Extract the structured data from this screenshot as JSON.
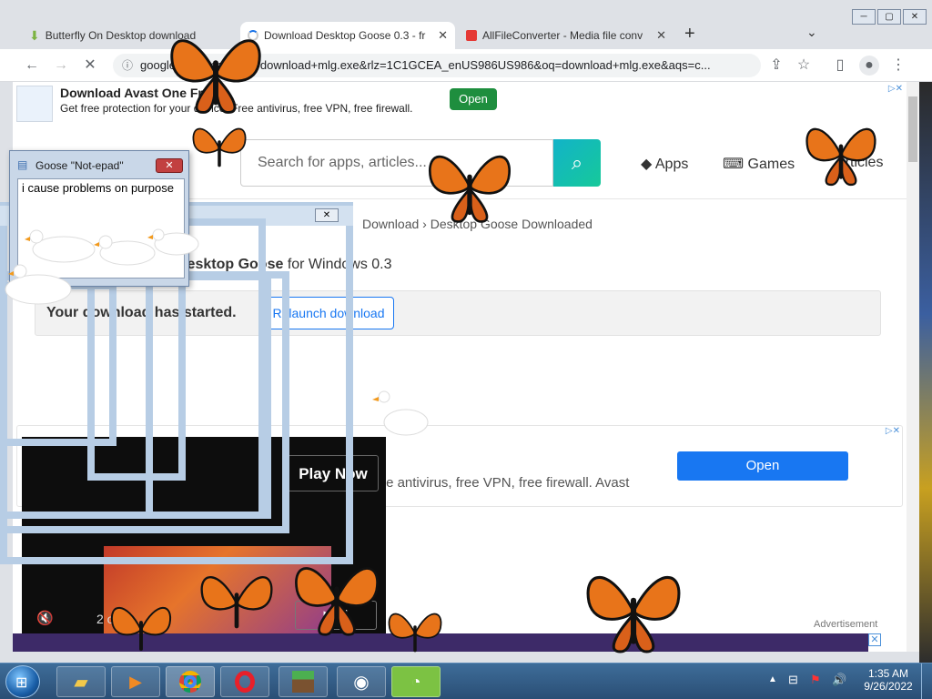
{
  "browser": {
    "tabs": [
      {
        "title": "Butterfly On Desktop download"
      },
      {
        "title": "Download Desktop Goose 0.3 - fr"
      },
      {
        "title": "AllFileConverter - Media file conv"
      }
    ],
    "new_tab": "+",
    "window_controls": [
      "─",
      "▢",
      "✕"
    ],
    "url": "google.com/search?q=download+mlg.exe&rlz=1C1GCEA_enUS986US986&oq=download+mlg.exe&aqs=c..."
  },
  "ad_top": {
    "title": "Download Avast One Free",
    "desc": "Get free protection for your device. Free antivirus, free VPN, free firewall.",
    "button": "Open"
  },
  "site": {
    "search_placeholder": "Search for apps, articles...",
    "nav": [
      "Apps",
      "Games",
      "Articles"
    ],
    "breadcrumb": [
      "Download",
      "Desktop Goose Downloaded"
    ],
    "heading_bold": "Desktop Goose",
    "heading_rest": "for Windows 0.3",
    "download_msg": "Your download has started.",
    "relaunch": "Relaunch download"
  },
  "ad_mid": {
    "text": "Get free protection. Free antivirus, free VPN, free firewall. Avast",
    "button": "Open"
  },
  "video": {
    "play": "Play Now",
    "counter": "2 of 4",
    "label": "Advertisement"
  },
  "notepad": {
    "title": "Goose \"Not-epad\"",
    "text": "i cause problems on purpose"
  },
  "taskbar": {
    "time": "1:35 AM",
    "date": "9/26/2022"
  },
  "colors": {
    "accent_blue": "#1877f2",
    "open_green": "#1e8e3e",
    "search_teal": "#12b3c8",
    "taskbar": "#2d5a87"
  }
}
